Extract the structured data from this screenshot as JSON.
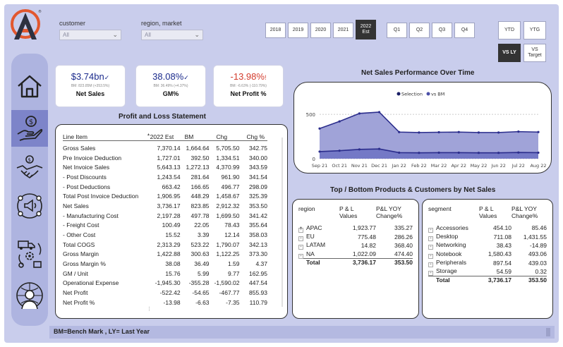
{
  "filters": {
    "customer": {
      "label": "customer",
      "value": "All"
    },
    "region": {
      "label": "region, market",
      "value": "All"
    }
  },
  "years": [
    "2018",
    "2019",
    "2020",
    "2021",
    "2022\nEst"
  ],
  "quarters": [
    "Q1",
    "Q2",
    "Q3",
    "Q4"
  ],
  "periods": [
    "YTD",
    "YTG"
  ],
  "compare": [
    "VS LY",
    "VS\nTarget"
  ],
  "colors": {
    "positive": "#1a2a8c",
    "negative": "#d33b2c",
    "accent": "#7d84c9",
    "line": "#2b2d8c",
    "area": "#8f93d1"
  },
  "kpis": [
    {
      "value": "$3.74bn",
      "mark": "✓",
      "sub": "BM: 823.85M (+353.5%)",
      "label": "Net Sales",
      "color": "#1a2a8c"
    },
    {
      "value": "38.08%",
      "mark": "✓",
      "sub": "BM: 36.49% (+4.37%)",
      "label": "GM%",
      "color": "#1a2a8c"
    },
    {
      "value": "-13.98%",
      "mark": "!",
      "sub": "BM: -6.63% (-110.79%)",
      "label": "Net Profit %",
      "color": "#d33b2c"
    }
  ],
  "pl": {
    "title": "Profit and Loss Statement",
    "headers": [
      "Line Item",
      "2022 Est",
      "BM",
      "Chg",
      "Chg %"
    ],
    "rows": [
      [
        "Gross Sales",
        "7,370.14",
        "1,664.64",
        "5,705.50",
        "342.75"
      ],
      [
        "Pre Invoice Deduction",
        "1,727.01",
        "392.50",
        "1,334.51",
        "340.00"
      ],
      [
        "Net Invoice Sales",
        "5,643.13",
        "1,272.13",
        "4,370.99",
        "343.59"
      ],
      [
        "- Post Discounts",
        "1,243.54",
        "281.64",
        "961.90",
        "341.54"
      ],
      [
        "- Post Deductions",
        "663.42",
        "166.65",
        "496.77",
        "298.09"
      ],
      [
        "Total Post Invoice Deduction",
        "1,906.95",
        "448.29",
        "1,458.67",
        "325.39"
      ],
      [
        "Net Sales",
        "3,736.17",
        "823.85",
        "2,912.32",
        "353.50"
      ],
      [
        "- Manufacturing Cost",
        "2,197.28",
        "497.78",
        "1,699.50",
        "341.42"
      ],
      [
        "- Freight Cost",
        "100.49",
        "22.05",
        "78.43",
        "355.64"
      ],
      [
        "- Other Cost",
        "15.52",
        "3.39",
        "12.14",
        "358.03"
      ],
      [
        "Total COGS",
        "2,313.29",
        "523.22",
        "1,790.07",
        "342.13"
      ],
      [
        "Gross Margin",
        "1,422.88",
        "300.63",
        "1,122.25",
        "373.30"
      ],
      [
        "Gross Margin %",
        "38.08",
        "36.49",
        "1.59",
        "4.37"
      ],
      [
        "GM / Unit",
        "15.76",
        "5.99",
        "9.77",
        "162.95"
      ],
      [
        "Operational Expense",
        "-1,945.30",
        "-355.28",
        "-1,590.02",
        "447.54"
      ],
      [
        "Net Profit",
        "-522.42",
        "-54.65",
        "-467.77",
        "855.93"
      ],
      [
        "Net Profit %",
        "-13.98",
        "-6.63",
        "-7.35",
        "110.79"
      ]
    ]
  },
  "chart_data": {
    "type": "area",
    "title": "Net Sales Performance Over Time",
    "categories": [
      "Sep 21",
      "Oct 21",
      "Nov 21",
      "Dec 21",
      "Jan 22",
      "Feb 22",
      "Mar 22",
      "Apr 22",
      "May 22",
      "Jun 22",
      "Jul 22",
      "Aug 22"
    ],
    "series": [
      {
        "name": "Selection",
        "values": [
          340,
          420,
          510,
          525,
          300,
          295,
          298,
          300,
          295,
          295,
          305,
          300
        ]
      },
      {
        "name": "vs BM",
        "values": [
          80,
          90,
          105,
          110,
          68,
          66,
          68,
          68,
          66,
          66,
          70,
          68
        ]
      }
    ],
    "yticks": [
      0,
      500
    ],
    "ylim": [
      0,
      620
    ],
    "legend": "top-center",
    "grid": true
  },
  "tb_title": "Top / Bottom Products & Customers by Net Sales",
  "region_table": {
    "headers": [
      "region",
      "P & L\nValues",
      "P&L YOY\nChange%"
    ],
    "rows": [
      [
        "APAC",
        "1,923.77",
        "335.27"
      ],
      [
        "EU",
        "775.48",
        "286.26"
      ],
      [
        "LATAM",
        "14.82",
        "368.40"
      ],
      [
        "NA",
        "1,022.09",
        "474.40"
      ]
    ],
    "total": [
      "Total",
      "3,736.17",
      "353.50"
    ]
  },
  "segment_table": {
    "headers": [
      "segment",
      "P & L\nValues",
      "P&L YOY\nChange%"
    ],
    "rows": [
      [
        "Accessories",
        "454.10",
        "85.46"
      ],
      [
        "Desktop",
        "711.08",
        "1,431.55"
      ],
      [
        "Networking",
        "38.43",
        "-14.89"
      ],
      [
        "Notebook",
        "1,580.43",
        "493.06"
      ],
      [
        "Peripherals",
        "897.54",
        "439.03"
      ],
      [
        "Storage",
        "54.59",
        "0.32"
      ]
    ],
    "total": [
      "Total",
      "3,736.17",
      "353.50"
    ]
  },
  "footer": "BM=Bench Mark , LY= Last Year",
  "nav_icons": [
    "home-icon",
    "money-hand-icon",
    "handshake-icon",
    "marketing-icon",
    "supply-chain-icon",
    "executive-icon"
  ]
}
